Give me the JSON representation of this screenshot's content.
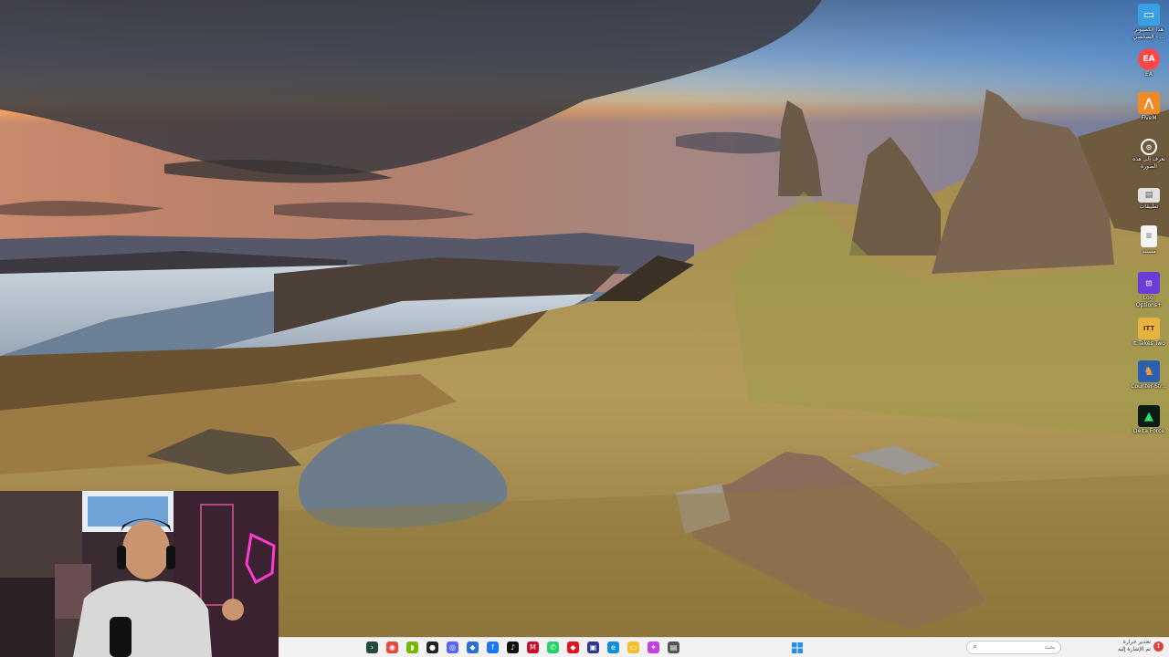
{
  "desktop": {
    "wallpaper": "isle-of-skye-old-man-of-storr-sunrise",
    "icons": [
      {
        "label": "هذا الكمبيوتر",
        "label2": "الشخصي - ...",
        "icon": "this-pc-icon",
        "color": "#3aa0e6"
      },
      {
        "label": "EA",
        "icon": "ea-app-icon",
        "color": "#ff4747"
      },
      {
        "label": "FiveM",
        "icon": "fivem-icon",
        "color": "#f08a24"
      },
      {
        "label": "تعرف إلى هذه",
        "label2": "الصورة",
        "icon": "learn-about-picture-icon",
        "color": "#444444"
      },
      {
        "label": "تطبيقات",
        "icon": "apps-folder-icon",
        "color": "#e0e0e0"
      },
      {
        "label": "مستند",
        "icon": "document-icon",
        "color": "#f5f5f5"
      },
      {
        "label": "Logi",
        "label2": "Options+",
        "icon": "logi-options-icon",
        "color": "#6c3bd8"
      },
      {
        "label": "It Takes Two",
        "icon": "it-takes-two-icon",
        "color": "#e8b240"
      },
      {
        "label": "Counter-Str...",
        "icon": "counter-strike-icon",
        "color": "#2b5fb0"
      },
      {
        "label": "Delta Force",
        "icon": "delta-force-icon",
        "color": "#1c8a3a"
      }
    ]
  },
  "webcam": {
    "label": "webcam-overlay"
  },
  "taskbar": {
    "start_icon": "windows-start-icon",
    "search": {
      "placeholder": "بحث"
    },
    "pinned": [
      {
        "name": "terminal-icon",
        "color": "#1f4d3a"
      },
      {
        "name": "chrome-icon",
        "color": "#e9483c"
      },
      {
        "name": "nvidia-icon",
        "color": "#76b900"
      },
      {
        "name": "github-icon",
        "color": "#222222"
      },
      {
        "name": "discord-icon",
        "color": "#5865f2"
      },
      {
        "name": "shield-icon",
        "color": "#2a6fd6"
      },
      {
        "name": "facebook-icon",
        "color": "#1877f2"
      },
      {
        "name": "tiktok-icon",
        "color": "#111111"
      },
      {
        "name": "mcafee-icon",
        "color": "#c8102e"
      },
      {
        "name": "whatsapp-icon",
        "color": "#25d366"
      },
      {
        "name": "red-app-icon",
        "color": "#e0151f"
      },
      {
        "name": "app-store-icon",
        "color": "#2f3a8f"
      },
      {
        "name": "edge-icon",
        "color": "#0f8fd6"
      },
      {
        "name": "file-explorer-icon",
        "color": "#f3c02d"
      },
      {
        "name": "copilot-icon",
        "color": "#c23fe3"
      },
      {
        "name": "notepad-icon",
        "color": "#555555"
      }
    ],
    "tray": {
      "line1": "تحذير حرارة",
      "line2": "تم الإشارة إليه",
      "alert_icon": "warning-icon"
    }
  }
}
